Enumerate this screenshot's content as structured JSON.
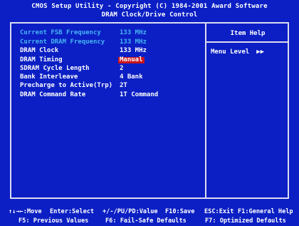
{
  "header": {
    "title": "CMOS Setup Utility - Copyright (C) 1984-2001 Award Software",
    "subtitle": "DRAM Clock/Drive Control"
  },
  "settings": [
    {
      "label": "Current FSB Frequency",
      "value": "133 MHz"
    },
    {
      "label": "Current DRAM Frequency",
      "value": "133 MHz"
    },
    {
      "label": "DRAM Clock",
      "value": "133 MHz"
    },
    {
      "label": "DRAM Timing",
      "value": "Manual"
    },
    {
      "label": "SDRAM Cycle Length",
      "value": "2"
    },
    {
      "label": "Bank Interleave",
      "value": "4 Bank"
    },
    {
      "label": "Precharge to Active(Trp)",
      "value": "2T"
    },
    {
      "label": "DRAM Command Rate",
      "value": "1T Command"
    }
  ],
  "help_panel": {
    "title": "Item Help",
    "menu_level_label": "Menu Level",
    "menu_level_arrows": "▶▶"
  },
  "footer": {
    "line1": [
      "↑↓→←:Move",
      "Enter:Select",
      "+/-/PU/PD:Value",
      "F10:Save",
      "ESC:Exit",
      "F1:General Help"
    ],
    "line2": [
      "F5: Previous Values",
      "F6: Fail-Safe Defaults",
      "F7: Optimized Defaults"
    ]
  },
  "colors": {
    "background": "#0b1fc4",
    "text": "#ffffff",
    "dimmed_text": "#46b4f2",
    "highlight": "#c8141e"
  }
}
